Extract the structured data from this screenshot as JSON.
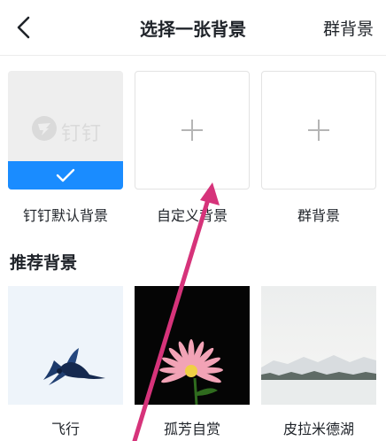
{
  "nav": {
    "title": "选择一张背景",
    "right_action": "群背景"
  },
  "options": [
    {
      "label": "钉钉默认背景",
      "watermark": "钉钉",
      "selected": true
    },
    {
      "label": "自定义背景",
      "selected": false
    },
    {
      "label": "群背景",
      "selected": false
    }
  ],
  "recommended": {
    "title": "推荐背景",
    "items": [
      {
        "label": "飞行"
      },
      {
        "label": "孤芳自赏"
      },
      {
        "label": "皮拉米德湖"
      }
    ]
  },
  "colors": {
    "accent": "#1a8cff",
    "annotation_arrow": "#d6337a"
  }
}
